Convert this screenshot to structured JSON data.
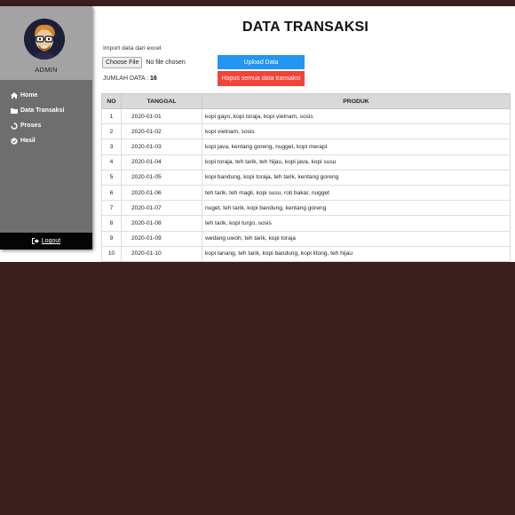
{
  "sidebar": {
    "user_label": "ADMIN",
    "items": [
      {
        "label": "Home",
        "icon": "home-icon"
      },
      {
        "label": "Data Transaksi",
        "icon": "folder-icon"
      },
      {
        "label": "Proses",
        "icon": "refresh-icon"
      },
      {
        "label": "Hasil",
        "icon": "check-circle-icon"
      }
    ],
    "logout_label": "Logout"
  },
  "main": {
    "title": "DATA TRANSAKSI",
    "import_label": "Import data dari excel",
    "choose_file_label": "Choose File",
    "no_file_text": "No file chosen",
    "upload_label": "Upload Data",
    "delete_all_label": "Hapus semua data transaksi",
    "count_label": "JUMLAH DATA : ",
    "count_value": "16"
  },
  "table": {
    "headers": [
      "NO",
      "TANGGAL",
      "PRODUK"
    ],
    "rows": [
      {
        "no": "1",
        "tanggal": "2020-01-01",
        "produk": "kopi gayo, kopi toraja, kopi vietnam, sosis"
      },
      {
        "no": "2",
        "tanggal": "2020-01-02",
        "produk": "kopi vietnam, sosis"
      },
      {
        "no": "3",
        "tanggal": "2020-01-03",
        "produk": "kopi java, kentang goreng, nugget, kopi merapi"
      },
      {
        "no": "4",
        "tanggal": "2020-01-04",
        "produk": "kopi toraja, teh tarik, teh hijau, kopi java, kopi susu"
      },
      {
        "no": "5",
        "tanggal": "2020-01-05",
        "produk": "kopi bandung, kopi toraja, teh tarik, kentang goreng"
      },
      {
        "no": "6",
        "tanggal": "2020-01-06",
        "produk": "teh tarik, teh magli, kopi susu, roti bakar, nugget"
      },
      {
        "no": "7",
        "tanggal": "2020-01-07",
        "produk": "nuget, teh tarik, kopi bandung, kentang goreng"
      },
      {
        "no": "8",
        "tanggal": "2020-01-08",
        "produk": "teh tarik, kopi turgo, sosis"
      },
      {
        "no": "9",
        "tanggal": "2020-01-09",
        "produk": "wedang uwoh, teh tarik, kopi toraja"
      },
      {
        "no": "10",
        "tanggal": "2020-01-10",
        "produk": "kopi lanang, teh tarik, kopi bandung, kopi litong, teh hijau"
      }
    ]
  },
  "colors": {
    "background": "#3a1f1c",
    "sidebar_head": "#a3a3a3",
    "sidebar_body": "#6e6e6e",
    "upload_button": "#2196f3",
    "delete_button": "#f44336",
    "logout_bar": "#050505"
  }
}
